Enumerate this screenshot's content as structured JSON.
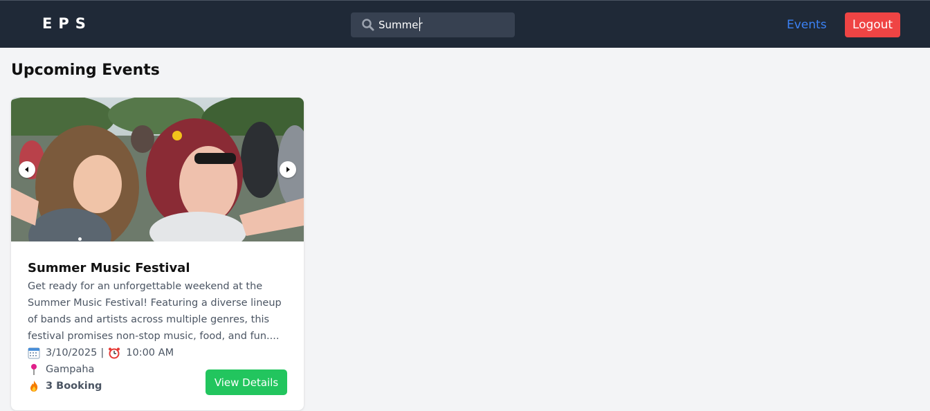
{
  "header": {
    "logo": "EPS",
    "search": {
      "value": "Summer"
    },
    "nav": {
      "events_label": "Events",
      "logout_label": "Logout"
    }
  },
  "main": {
    "title": "Upcoming Events",
    "events": [
      {
        "title": "Summer Music Festival",
        "description": "Get ready for an unforgettable weekend at the Summer Music Festival! Featuring a diverse lineup of bands and artists across multiple genres, this festival promises non-stop music, food, and fun....",
        "date": "3/10/2025",
        "time": "10:00 AM",
        "location": "Gampaha",
        "bookings": "3 Booking",
        "button_label": "View Details"
      }
    ]
  },
  "colors": {
    "header_bg": "#1f2937",
    "search_bg": "#374151",
    "link": "#3b82f6",
    "logout": "#ef4444",
    "view_details": "#22c55e",
    "page_bg": "#f3f4f6"
  }
}
